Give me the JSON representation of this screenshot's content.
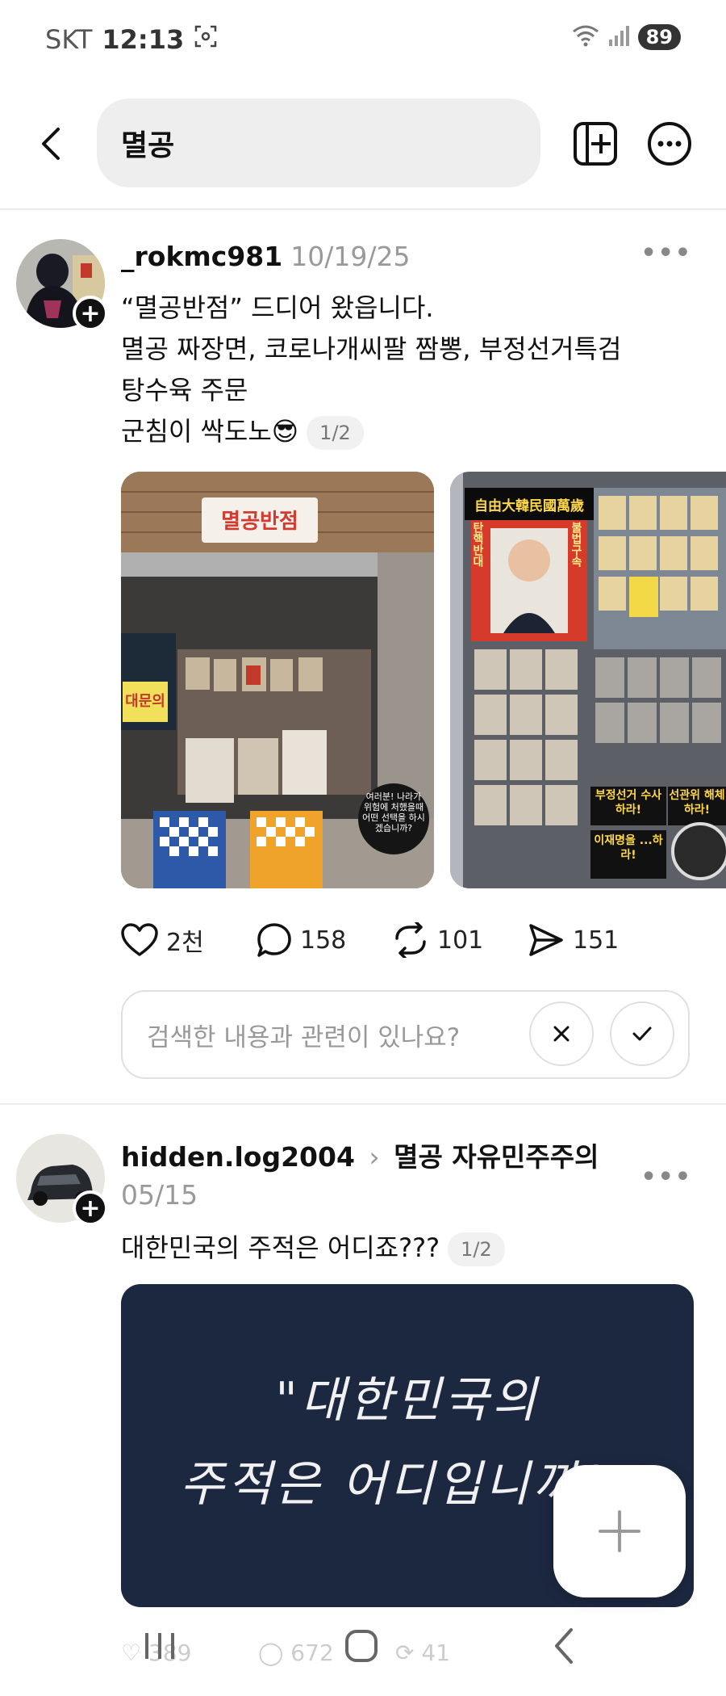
{
  "status_bar": {
    "carrier": "SKT",
    "time": "12:13",
    "battery": "89"
  },
  "header": {
    "search_query": "멸공"
  },
  "posts": [
    {
      "username": "_rokmc981",
      "date": "10/19/25",
      "lines": [
        "“멸공반점” 드디어 왔읍니다.",
        "멸공 짜장면, 코로나개씨팔 짬뽕, 부정선거특검",
        "탕수육 주문",
        "군침이 싹도노😎"
      ],
      "image_count": "1/2",
      "image1_sign": "멸공반점",
      "image1_window_sign": "대문의",
      "image1_board_text": "여러분! 나라가 위험에 처했을때 어떤 선택을 하시겠습니까?",
      "image2_banner": "自由大韓民國萬歲",
      "image2_side_left": "탄핵반대",
      "image2_side_right": "불법구속",
      "image2_sign1": "부정선거 수사하라!",
      "image2_sign2": "선관위 해체하라!",
      "image2_sign3": "이재명을 ...하라!",
      "likes": "2천",
      "comments": "158",
      "reposts": "101",
      "shares": "151",
      "feedback_prompt": "검색한 내용과 관련이 있나요?"
    },
    {
      "username": "hidden.log2004",
      "topic": "멸공 자유민주주의",
      "date": "05/15",
      "text": "대한민국의 주적은 어디죠???",
      "image_count": "1/2",
      "image_text_line1": "\"대한민국의",
      "image_text_line2": "주적은 어디입니까?\"",
      "likes": "389",
      "comments": "672",
      "reposts": "41"
    }
  ]
}
